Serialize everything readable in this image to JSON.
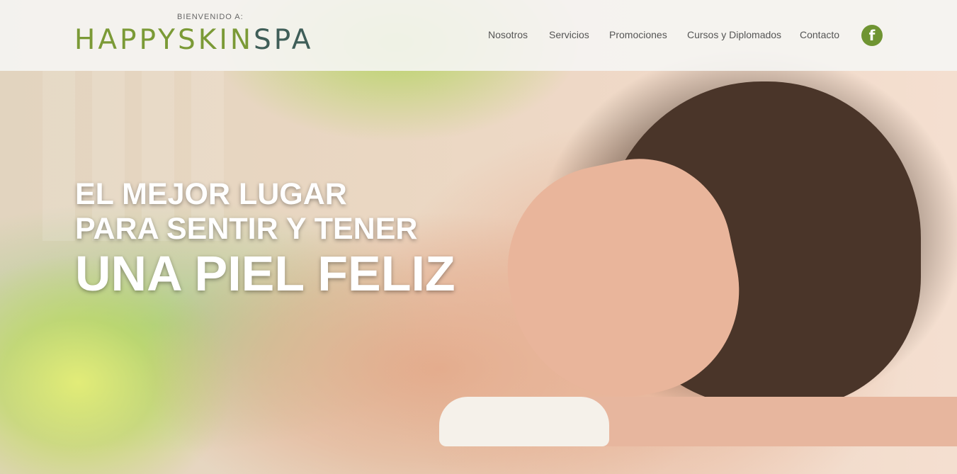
{
  "header": {
    "welcome": "BIENVENIDO A:",
    "brand_part1": "HAPPYSKIN",
    "brand_part2": "SPA",
    "colors": {
      "brand_green": "#7b9a36",
      "brand_teal": "#3f5e58",
      "facebook_bg": "#6f9432"
    }
  },
  "nav": {
    "items": [
      {
        "label": "Nosotros"
      },
      {
        "label": "Servicios"
      },
      {
        "label": "Promociones"
      },
      {
        "label": "Cursos y Diplomados"
      },
      {
        "label": "Contacto"
      }
    ],
    "facebook_glyph": "f",
    "facebook_icon": "facebook-icon"
  },
  "hero": {
    "line1": "EL MEJOR LUGAR",
    "line2": "PARA SENTIR Y TENER",
    "line3": "UNA PIEL FELIZ"
  }
}
